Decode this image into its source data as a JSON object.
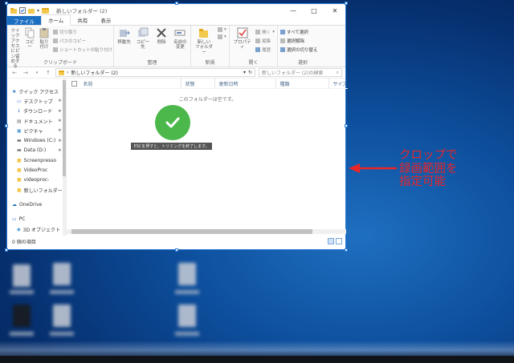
{
  "window": {
    "title": "新しいフォルダー (2)",
    "controls": {
      "minimize": "—",
      "maximize": "□",
      "close": "✕"
    }
  },
  "ribbon_tabs": [
    "ファイル",
    "ホーム",
    "共有",
    "表示"
  ],
  "ribbon": {
    "clipboard": {
      "label": "クリップボード",
      "pin": "クイック アクセス\nにピン留めする",
      "copy": "コピー",
      "paste": "貼り付け",
      "cut": "切り取り",
      "copy_path": "パスのコピー",
      "paste_shortcut": "ショートカットの貼り付け"
    },
    "organize": {
      "label": "整理",
      "move_to": "移動先",
      "copy_to": "コピー先",
      "delete": "削除",
      "rename": "名前の\n変更"
    },
    "new": {
      "label": "新規",
      "new_folder": "新しい\nフォルダー"
    },
    "open": {
      "label": "開く",
      "properties": "プロパティ",
      "open": "開く",
      "edit": "編集",
      "history": "履歴"
    },
    "select": {
      "label": "選択",
      "select_all": "すべて選択",
      "select_none": "選択解除",
      "invert": "選択の切り替え"
    }
  },
  "address": {
    "path": "新しいフォルダー (2)",
    "search_placeholder": "新しいフォルダー (2)の検索"
  },
  "columns": [
    "名前",
    "状態",
    "更新日時",
    "種類",
    "サイズ"
  ],
  "empty_message": "このフォルダーは空です。",
  "toast": "ESCを押すと、トリミングを終了します。",
  "nav_items": [
    {
      "label": "クイック アクセス",
      "icon": "star-icon",
      "pinned": false,
      "top": true
    },
    {
      "label": "デスクトップ",
      "icon": "desktop-icon",
      "pinned": true,
      "top": false
    },
    {
      "label": "ダウンロード",
      "icon": "download-icon",
      "pinned": true,
      "top": false
    },
    {
      "label": "ドキュメント",
      "icon": "document-icon",
      "pinned": true,
      "top": false
    },
    {
      "label": "ピクチャ",
      "icon": "picture-icon",
      "pinned": true,
      "top": false
    },
    {
      "label": "Windows (C:)",
      "icon": "drive-icon",
      "pinned": true,
      "top": false
    },
    {
      "label": "Data (D:)",
      "icon": "drive-icon",
      "pinned": true,
      "top": false
    },
    {
      "label": "Screenpresso",
      "icon": "folder-icon",
      "pinned": false,
      "top": false
    },
    {
      "label": "VideoProc",
      "icon": "folder-icon",
      "pinned": false,
      "top": false
    },
    {
      "label": "videoproc-",
      "icon": "folder-icon",
      "pinned": false,
      "top": false
    },
    {
      "label": "新しいフォルダー",
      "icon": "folder-icon",
      "pinned": false,
      "top": false
    },
    {
      "label": "OneDrive",
      "icon": "cloud-icon",
      "pinned": false,
      "top": true
    },
    {
      "label": "PC",
      "icon": "pc-icon",
      "pinned": false,
      "top": true
    },
    {
      "label": "3D オブジェクト",
      "icon": "cube-icon",
      "pinned": false,
      "top": false
    }
  ],
  "status": {
    "count": "0 個の項目"
  },
  "annotation": {
    "line1": "クロップで",
    "line2": "録画範囲を",
    "line3": "指定可能",
    "color": "#e8262a"
  },
  "colors": {
    "selection_border": "#2a7ad6",
    "file_tab": "#1b6ec2",
    "check_green": "#4cb84c"
  }
}
